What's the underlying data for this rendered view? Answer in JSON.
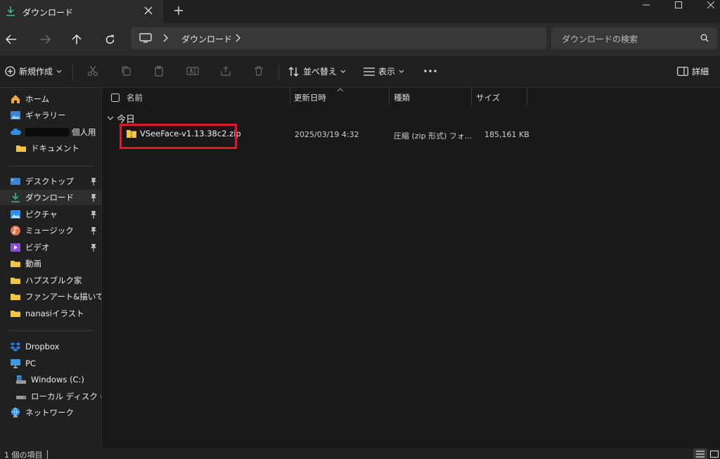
{
  "tab": {
    "title": "ダウンロード",
    "close": "×",
    "new": "+"
  },
  "address": {
    "crumb": "ダウンロード"
  },
  "search": {
    "placeholder": "ダウンロードの検索"
  },
  "toolbar": {
    "new_label": "新規作成",
    "sort_label": "並べ替え",
    "view_label": "表示",
    "details_label": "詳細"
  },
  "sidebar": {
    "home": "ホーム",
    "gallery": "ギャラリー",
    "personal": "個人用",
    "documents": "ドキュメント",
    "desktop": "デスクトップ",
    "downloads": "ダウンロード",
    "pictures": "ピクチャ",
    "music": "ミュージック",
    "videos": "ビデオ",
    "folder_douga": "動画",
    "folder_habsburg": "ハプスブルク家",
    "folder_fanart": "ファンアート&描いてもら",
    "folder_nanasi": "nanasiイラスト",
    "dropbox": "Dropbox",
    "pc": "PC",
    "drive_c": "Windows (C:)",
    "drive_d": "ローカル ディスク (D:)",
    "network": "ネットワーク"
  },
  "columns": {
    "name": "名前",
    "date": "更新日時",
    "type": "種類",
    "size": "サイズ"
  },
  "group": {
    "label": "今日"
  },
  "files": [
    {
      "name": "VSeeFace-v1.13.38c2.zip",
      "date": "2025/03/19 4:32",
      "type": "圧縮 (zip 形式) フォ...",
      "size": "185,161 KB"
    }
  ],
  "status": {
    "count": "1 個の項目"
  },
  "colors": {
    "highlight": "#e0182a",
    "accent_download": "#3fb47c",
    "folder": "#f4c542"
  }
}
